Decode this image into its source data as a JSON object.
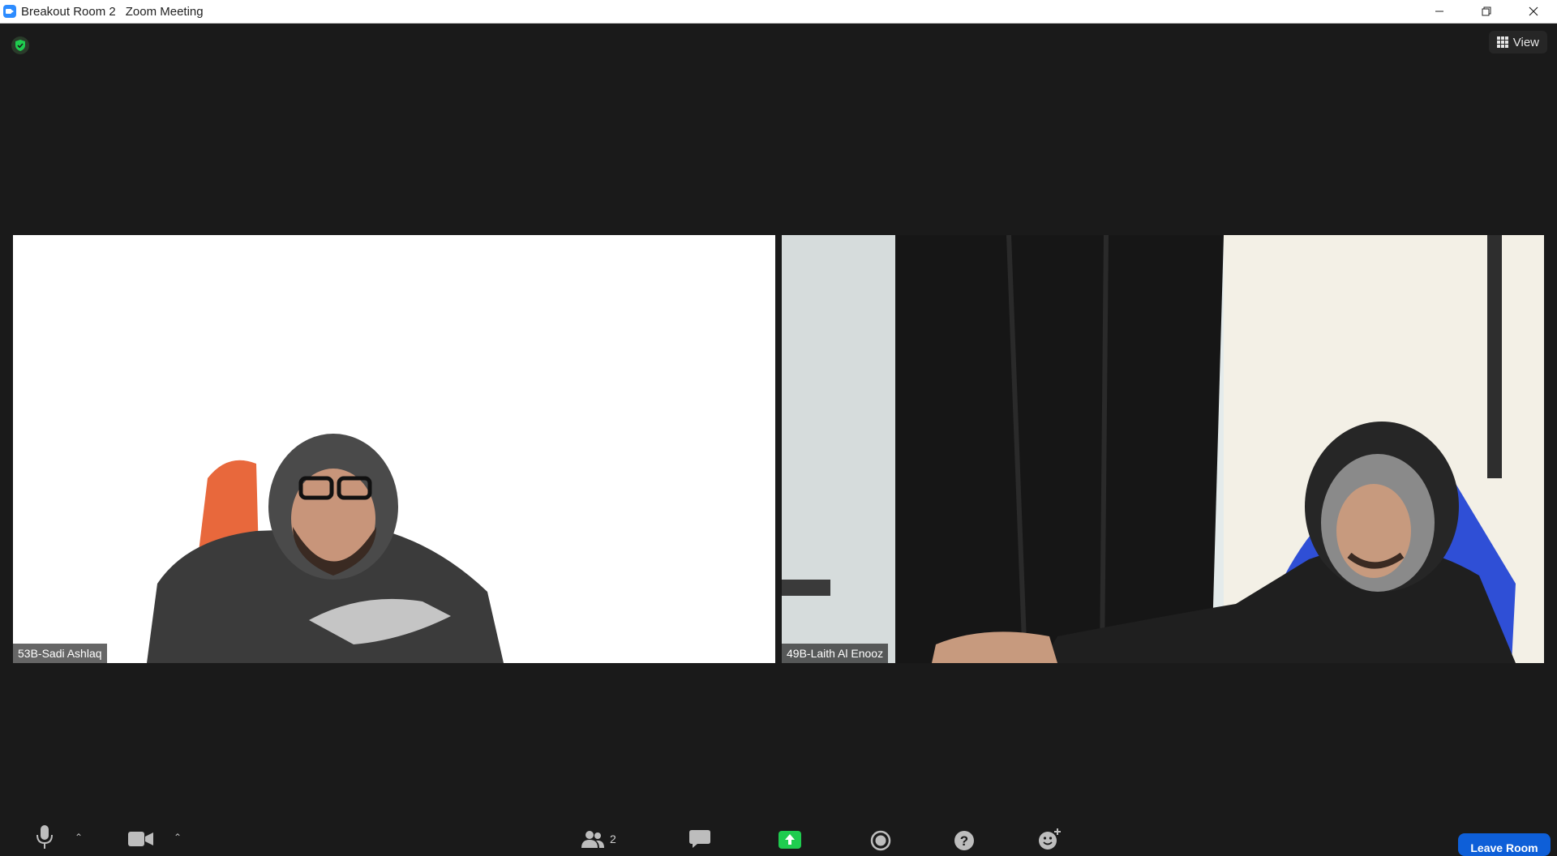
{
  "window": {
    "title_room": "Breakout Room 2",
    "title_app": "Zoom Meeting",
    "controls": [
      "minimize",
      "restore",
      "close"
    ]
  },
  "top": {
    "view_label": "View",
    "security_icon": "shield-check-icon"
  },
  "participants": [
    {
      "name": "53B-Sadi Ashlaq"
    },
    {
      "name": "49B-Laith Al Enooz"
    }
  ],
  "toolbar": {
    "mute_icon": "microphone-icon",
    "video_icon": "video-camera-icon",
    "participants_icon": "participants-icon",
    "participants_count": "2",
    "chat_icon": "chat-icon",
    "share_icon": "share-screen-icon",
    "record_icon": "record-icon",
    "help_icon": "help-icon",
    "reactions_icon": "reactions-icon",
    "leave_label": "Leave Room"
  },
  "colors": {
    "background": "#1a1a1a",
    "share_green": "#1fcc4f",
    "leave_blue": "#0e5fd8",
    "zoom_blue": "#2d8cff"
  }
}
